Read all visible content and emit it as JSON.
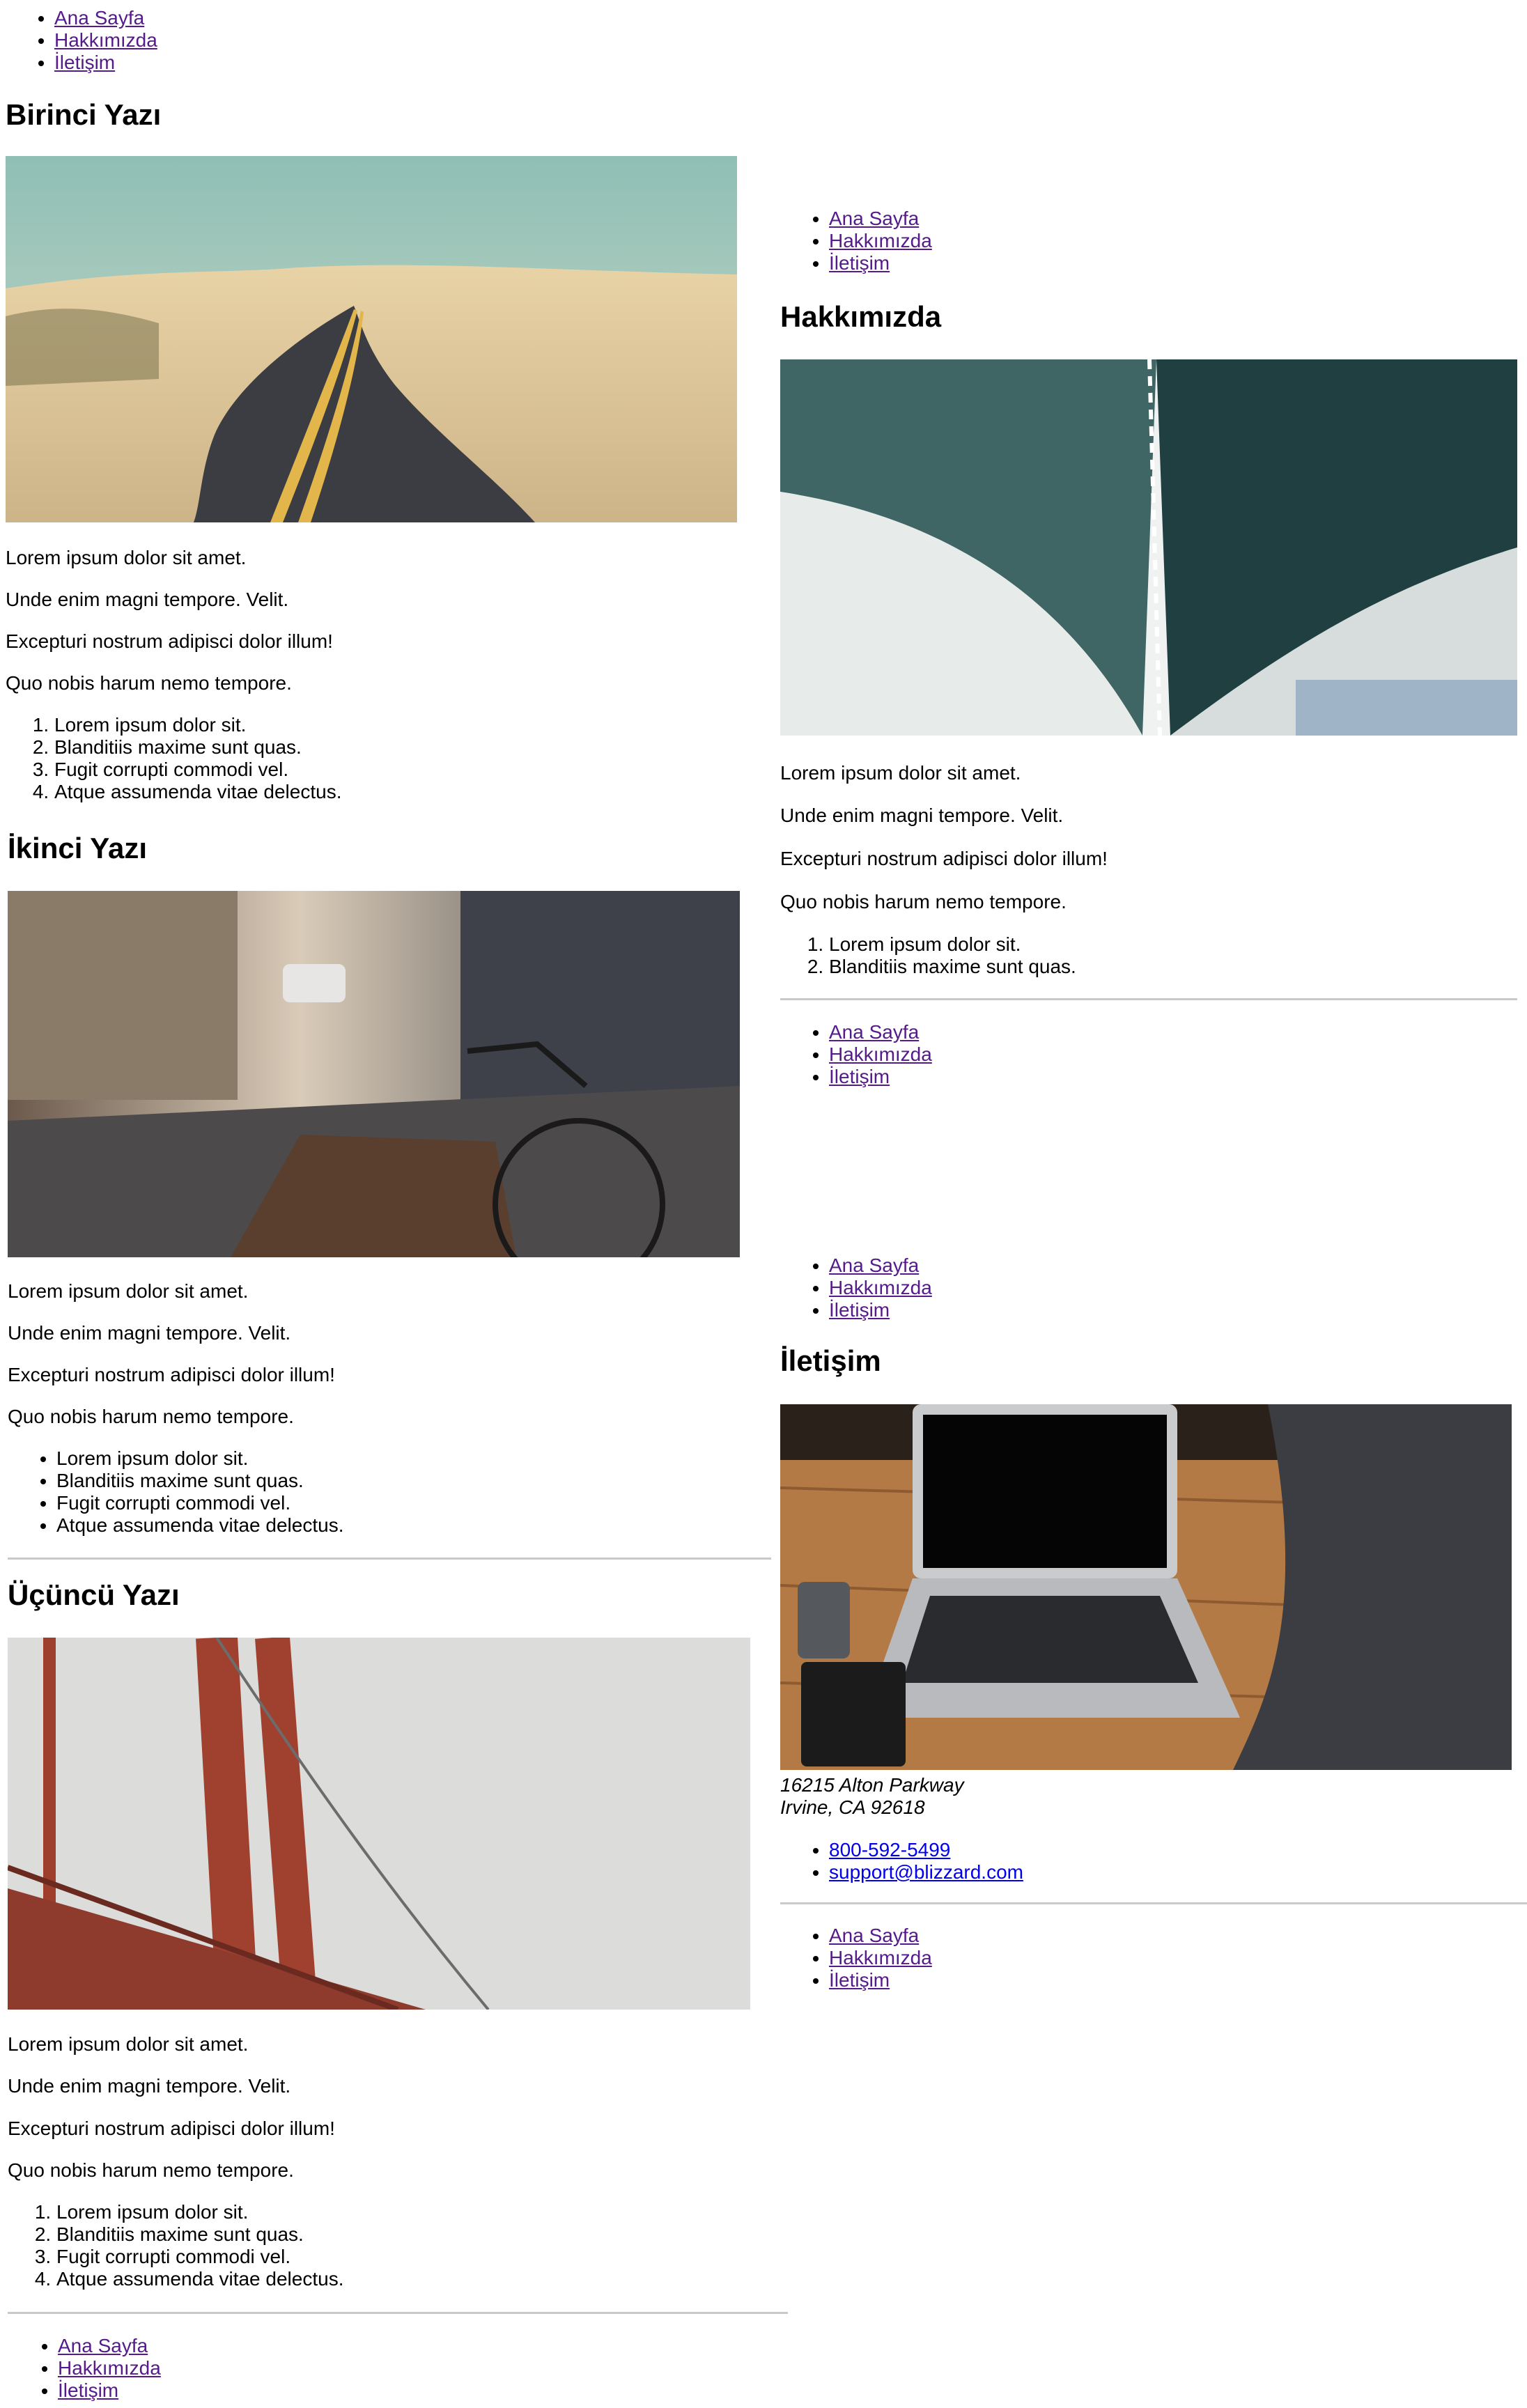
{
  "nav": [
    "Ana Sayfa",
    "Hakkımızda",
    "İletişim"
  ],
  "paragraphs": [
    "Lorem ipsum dolor sit amet.",
    "Unde enim magni tempore. Velit.",
    "Excepturi nostrum adipisci dolor illum!",
    "Quo nobis harum nemo tempore."
  ],
  "items": [
    "Lorem ipsum dolor sit.",
    "Blanditiis maxime sunt quas.",
    "Fugit corrupti commodi vel.",
    "Atque assumenda vitae delectus."
  ],
  "pages": {
    "birinci": {
      "title": "Birinci Yazı",
      "image": "desert-road-photo"
    },
    "ikinci": {
      "title": "İkinci Yazı",
      "image": "street-bicycle-photo"
    },
    "ucuncu": {
      "title": "Üçüncü Yazı",
      "image": "golden-gate-bridge-photo"
    },
    "hakkimizda": {
      "title": "Hakkımızda",
      "image": "bridge-underside-photo"
    },
    "iletisim": {
      "title": "İletişim",
      "image": "laptop-workspace-photo",
      "address_line1": "16215 Alton Parkway",
      "address_line2": "Irvine, CA 92618",
      "phone": "800-592-5499",
      "email": "support@blizzard.com"
    }
  },
  "colors": {
    "link_visited": "#551a8b",
    "link": "#0000ee",
    "rule": "#c9c9c9"
  }
}
